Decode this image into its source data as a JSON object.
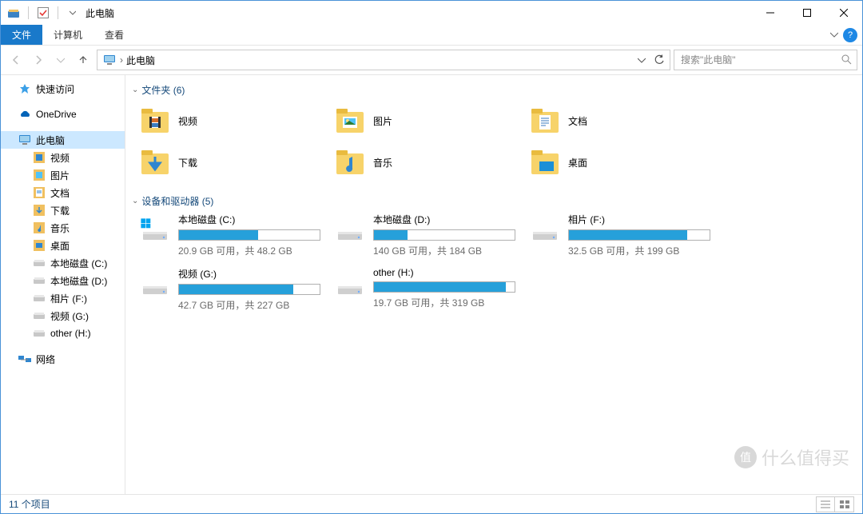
{
  "title": "此电脑",
  "ribbon": {
    "file": "文件",
    "tab1": "计算机",
    "tab2": "查看"
  },
  "breadcrumb": {
    "root": "此电脑"
  },
  "search": {
    "placeholder": "搜索\"此电脑\""
  },
  "sidebar": {
    "quick_access": "快速访问",
    "onedrive": "OneDrive",
    "this_pc": "此电脑",
    "children": {
      "videos": "视频",
      "pictures": "图片",
      "documents": "文档",
      "downloads": "下载",
      "music": "音乐",
      "desktop": "桌面",
      "drive_c": "本地磁盘 (C:)",
      "drive_d": "本地磁盘 (D:)",
      "drive_f": "相片 (F:)",
      "drive_g": "视频 (G:)",
      "drive_h": "other (H:)"
    },
    "network": "网络"
  },
  "sections": {
    "folders_label": "文件夹 (6)",
    "drives_label": "设备和驱动器 (5)"
  },
  "folders": {
    "videos": "视频",
    "pictures": "图片",
    "documents": "文档",
    "downloads": "下载",
    "music": "音乐",
    "desktop": "桌面"
  },
  "drives": [
    {
      "name": "本地磁盘 (C:)",
      "space": "20.9 GB 可用，共 48.2 GB",
      "fill_pct": 56
    },
    {
      "name": "本地磁盘 (D:)",
      "space": "140 GB 可用，共 184 GB",
      "fill_pct": 24
    },
    {
      "name": "相片 (F:)",
      "space": "32.5 GB 可用，共 199 GB",
      "fill_pct": 84
    },
    {
      "name": "视频 (G:)",
      "space": "42.7 GB 可用，共 227 GB",
      "fill_pct": 81
    },
    {
      "name": "other (H:)",
      "space": "19.7 GB 可用，共 319 GB",
      "fill_pct": 94
    }
  ],
  "statusbar": {
    "count": "11 个项目"
  },
  "watermark": {
    "badge": "值",
    "text": "什么值得买"
  }
}
